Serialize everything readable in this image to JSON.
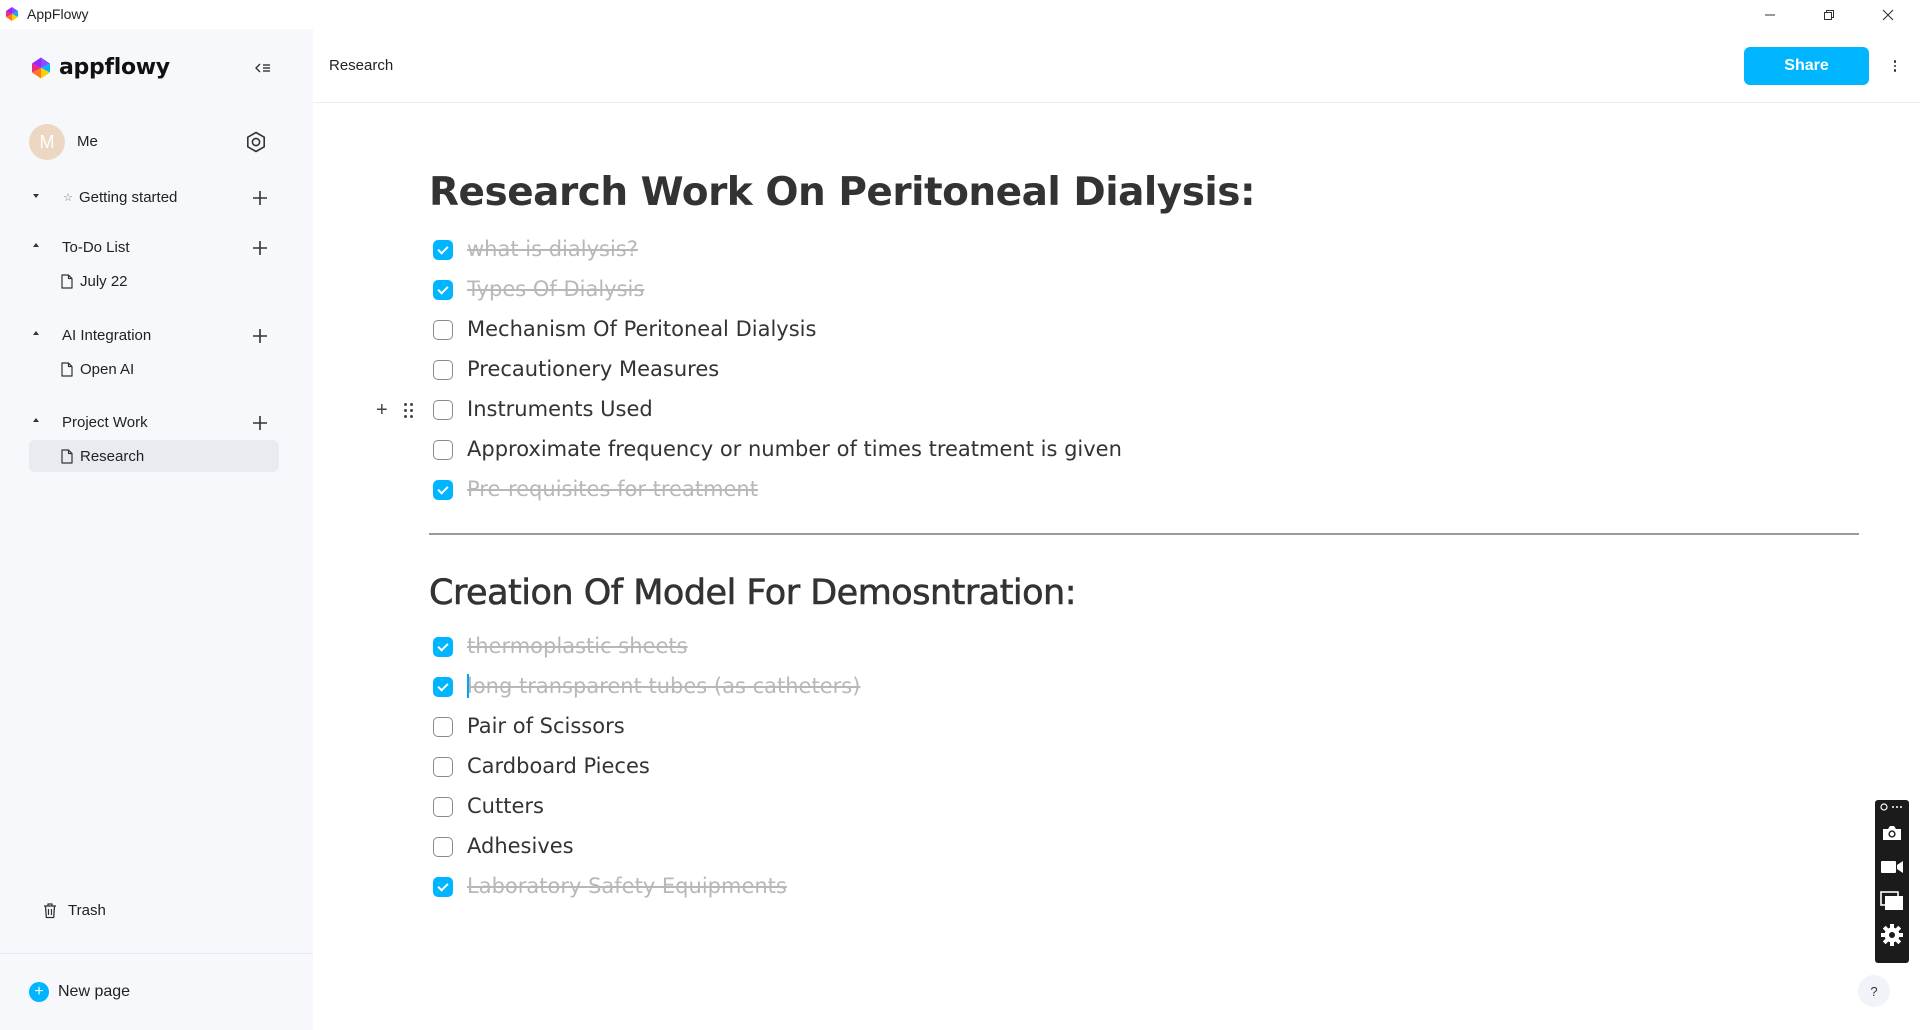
{
  "window": {
    "title": "AppFlowy",
    "controls": {
      "minimize_icon": "minimize-icon",
      "maximize_icon": "restore-icon",
      "close_icon": "close-icon"
    }
  },
  "sidebar": {
    "brand": "appflowy",
    "user": {
      "initial": "M",
      "name": "Me"
    },
    "sections": [
      {
        "label": "Getting started",
        "expanded": false,
        "starred": true,
        "pages": []
      },
      {
        "label": "To-Do List",
        "expanded": true,
        "pages": [
          {
            "label": "July 22"
          }
        ]
      },
      {
        "label": "AI Integration",
        "expanded": true,
        "pages": [
          {
            "label": "Open AI"
          }
        ]
      },
      {
        "label": "Project Work",
        "expanded": true,
        "pages": [
          {
            "label": "Research",
            "selected": true
          }
        ]
      }
    ],
    "trash_label": "Trash",
    "new_page_label": "New page"
  },
  "header": {
    "breadcrumb": "Research",
    "share_label": "Share"
  },
  "document": {
    "heading1": "Research Work On Peritoneal Dialysis:",
    "list1": [
      {
        "text": "what is dialysis?",
        "checked": true
      },
      {
        "text": "Types Of Dialysis",
        "checked": true
      },
      {
        "text": "Mechanism Of Peritoneal Dialysis",
        "checked": false
      },
      {
        "text": "Precautionery Measures",
        "checked": false
      },
      {
        "text": "Instruments Used",
        "checked": false
      },
      {
        "text": "Approximate frequency or number of times treatment is given",
        "checked": false
      },
      {
        "text": "Pre-requisites for treatment",
        "checked": true
      }
    ],
    "heading2": "Creation Of Model For Demosntration:",
    "list2": [
      {
        "text": "thermoplastic sheets",
        "checked": true
      },
      {
        "text": "long transparent tubes (as catheters)",
        "checked": true
      },
      {
        "text": "Pair of Scissors",
        "checked": false
      },
      {
        "text": "Cardboard Pieces",
        "checked": false
      },
      {
        "text": "Cutters",
        "checked": false
      },
      {
        "text": "Adhesives",
        "checked": false
      },
      {
        "text": "Laboratory Safety Equipments",
        "checked": true
      }
    ]
  },
  "help_label": "?",
  "colors": {
    "accent": "#00b5ff",
    "sidebar_bg": "#f7f8fc",
    "done_text": "#b8b8b8"
  }
}
